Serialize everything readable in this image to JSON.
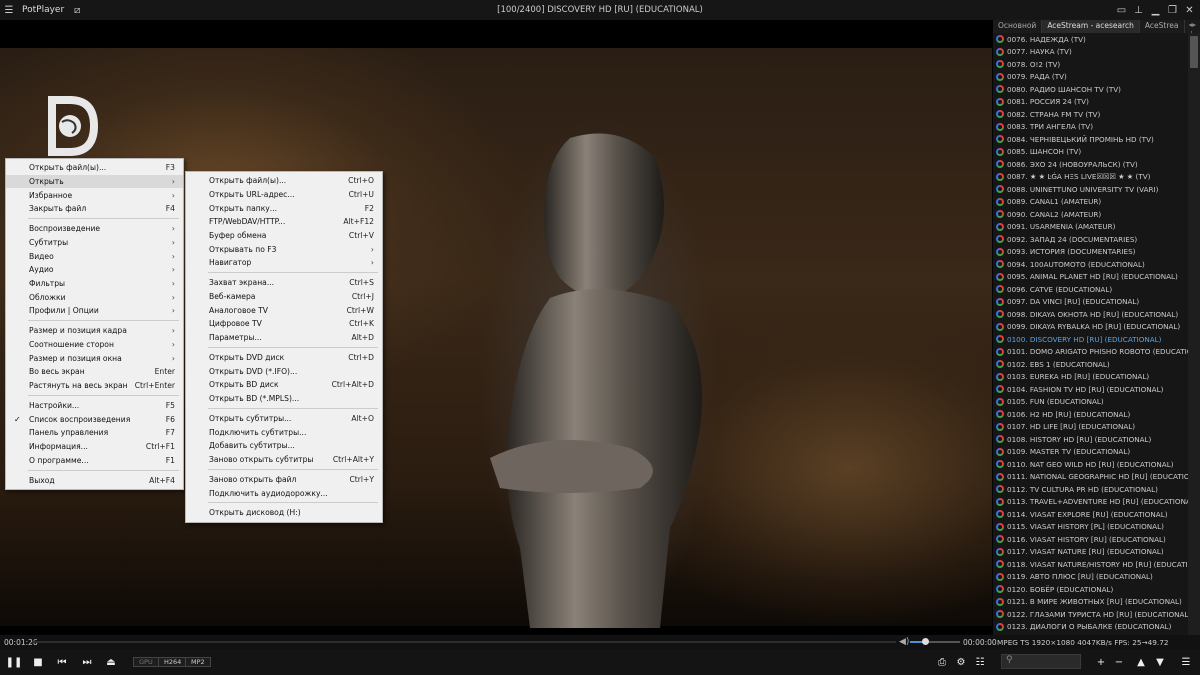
{
  "app_name": "PotPlayer",
  "window_title": "[100/2400] DISCOVERY HD [RU] (EDUCATIONAL)",
  "playlist_tabs": [
    "Основной",
    "AceStream - acesearch",
    "AceStrea"
  ],
  "playlist": [
    "0076. НАДЕЖДА (TV)",
    "0077. НАУКА (TV)",
    "0078. О!2 (TV)",
    "0079. РАДА (TV)",
    "0080. РАДИО ШАНСОН TV (TV)",
    "0081. РОССИЯ 24 (TV)",
    "0082. СТРАНА FM TV (TV)",
    "0083. ТРИ АНГЕЛА (TV)",
    "0084. ЧЕРНІВЕЦЬКИЙ ПРОМІНЬ HD (TV)",
    "0085. ШАНСОН (TV)",
    "0086. ЭХО 24 (НОВОУРАЛЬСК) (TV)",
    "0087. ★ ★ ĿĠA HΞS LIVE☒☒☒ ★ ★ (TV)",
    "0088. UNINETTUNO UNIVERSITY TV (VARI)",
    "0089. CANAL1 (AMATEUR)",
    "0090. CANAL2 (AMATEUR)",
    "0091. USARMENIA (AMATEUR)",
    "0092. ЗАПАД 24 (DOCUMENTARIES)",
    "0093. ИСТОРИЯ (DOCUMENTARIES)",
    "0094. 100AUTOMOTO (EDUCATIONAL)",
    "0095. ANIMAL PLANET HD [RU] (EDUCATIONAL)",
    "0096. CATVE (EDUCATIONAL)",
    "0097. DA VINCI [RU] (EDUCATIONAL)",
    "0098. DIKAYA OKHOTA HD [RU] (EDUCATIONAL)",
    "0099. DIKAYA RYBALKA HD [RU] (EDUCATIONAL)",
    "0100. DISCOVERY HD [RU] (EDUCATIONAL)",
    "0101. DOMO ARIGATO PHISHO ROBOTO (EDUCATIO...",
    "0102. EBS 1 (EDUCATIONAL)",
    "0103. EUREKA HD [RU] (EDUCATIONAL)",
    "0104. FASHION TV HD [RU] (EDUCATIONAL)",
    "0105. FUN (EDUCATIONAL)",
    "0106. H2 HD [RU] (EDUCATIONAL)",
    "0107. HD LIFE [RU] (EDUCATIONAL)",
    "0108. HISTORY HD [RU] (EDUCATIONAL)",
    "0109. MASTER TV (EDUCATIONAL)",
    "0110. NAT GEO WILD HD [RU] (EDUCATIONAL)",
    "0111. NATIONAL GEOGRAPHIC HD [RU] (EDUCATIO...",
    "0112. TV CULTURA PR HD (EDUCATIONAL)",
    "0113. TRAVEL+ADVENTURE HD [RU] (EDUCATIONAL)",
    "0114. VIASAT EXPLORE [RU] (EDUCATIONAL)",
    "0115. VIASAT HISTORY [PL] (EDUCATIONAL)",
    "0116. VIASAT HISTORY [RU] (EDUCATIONAL)",
    "0117. VIASAT NATURE [RU] (EDUCATIONAL)",
    "0118. VIASAT NATURE/HISTORY HD [RU] (EDUCATIO...",
    "0119. АВТО ПЛЮС [RU] (EDUCATIONAL)",
    "0120. БОБЁР (EDUCATIONAL)",
    "0121. В МИРЕ ЖИВОТНЫХ [RU] (EDUCATIONAL)",
    "0122. ГЛАЗАМИ ТУРИСТА HD [RU] (EDUCATIONAL)",
    "0123. ДИАЛОГИ О РЫБАЛКЕ (EDUCATIONAL)"
  ],
  "current_index": 24,
  "menu_main": [
    {
      "label": "Открыть файл(ы)...",
      "key": "F3"
    },
    {
      "label": "Открыть",
      "sub": true,
      "hl": true
    },
    {
      "label": "Избранное",
      "sub": true
    },
    {
      "label": "Закрыть файл",
      "key": "F4"
    },
    {
      "sep": true
    },
    {
      "label": "Воспроизведение",
      "sub": true
    },
    {
      "label": "Субтитры",
      "sub": true
    },
    {
      "label": "Видео",
      "sub": true
    },
    {
      "label": "Аудио",
      "sub": true
    },
    {
      "label": "Фильтры",
      "sub": true
    },
    {
      "label": "Обложки",
      "sub": true
    },
    {
      "label": "Профили | Опции",
      "sub": true
    },
    {
      "sep": true
    },
    {
      "label": "Размер и позиция кадра",
      "sub": true
    },
    {
      "label": "Соотношение сторон",
      "sub": true
    },
    {
      "label": "Размер и позиция окна",
      "sub": true
    },
    {
      "label": "Во весь экран",
      "key": "Enter"
    },
    {
      "label": "Растянуть на весь экран",
      "key": "Ctrl+Enter"
    },
    {
      "sep": true
    },
    {
      "label": "Настройки...",
      "key": "F5"
    },
    {
      "label": "Список воспроизведения",
      "key": "F6",
      "check": true
    },
    {
      "label": "Панель управления",
      "key": "F7"
    },
    {
      "label": "Информация...",
      "key": "Ctrl+F1"
    },
    {
      "label": "О программе...",
      "key": "F1"
    },
    {
      "sep": true
    },
    {
      "label": "Выход",
      "key": "Alt+F4"
    }
  ],
  "menu_open": [
    {
      "label": "Открыть файл(ы)...",
      "key": "Ctrl+O"
    },
    {
      "label": "Открыть URL-адрес...",
      "key": "Ctrl+U"
    },
    {
      "label": "Открыть папку...",
      "key": "F2"
    },
    {
      "label": "FTP/WebDAV/HTTP...",
      "key": "Alt+F12"
    },
    {
      "label": "Буфер обмена",
      "key": "Ctrl+V"
    },
    {
      "label": "Открывать по F3",
      "sub": true
    },
    {
      "label": "Навигатор",
      "sub": true
    },
    {
      "sep": true
    },
    {
      "label": "Захват экрана...",
      "key": "Ctrl+S"
    },
    {
      "label": "Веб-камера",
      "key": "Ctrl+J"
    },
    {
      "label": "Аналоговое TV",
      "key": "Ctrl+W"
    },
    {
      "label": "Цифровое TV",
      "key": "Ctrl+K"
    },
    {
      "label": "Параметры...",
      "key": "Alt+D"
    },
    {
      "sep": true
    },
    {
      "label": "Открыть DVD диск",
      "key": "Ctrl+D"
    },
    {
      "label": "Открыть DVD (*.IFO)..."
    },
    {
      "label": "Открыть BD диск",
      "key": "Ctrl+Alt+D"
    },
    {
      "label": "Открыть BD (*.MPLS)..."
    },
    {
      "sep": true
    },
    {
      "label": "Открыть субтитры...",
      "key": "Alt+O"
    },
    {
      "label": "Подключить субтитры..."
    },
    {
      "label": "Добавить субтитры..."
    },
    {
      "label": "Заново открыть субтитры",
      "key": "Ctrl+Alt+Y"
    },
    {
      "sep": true
    },
    {
      "label": "Заново открыть файл",
      "key": "Ctrl+Y"
    },
    {
      "label": "Подключить аудиодорожку..."
    },
    {
      "sep": true
    },
    {
      "label": "Открыть дисковод (H:)"
    }
  ],
  "time_elapsed": "00:01:26",
  "time_total": "00:00:00",
  "stream_info": "MPEG TS  1920×1080  4047KB/s  FPS: 25→49.72",
  "volume_level": 0.3,
  "badges": [
    "GPU",
    "H264",
    "MP2"
  ]
}
